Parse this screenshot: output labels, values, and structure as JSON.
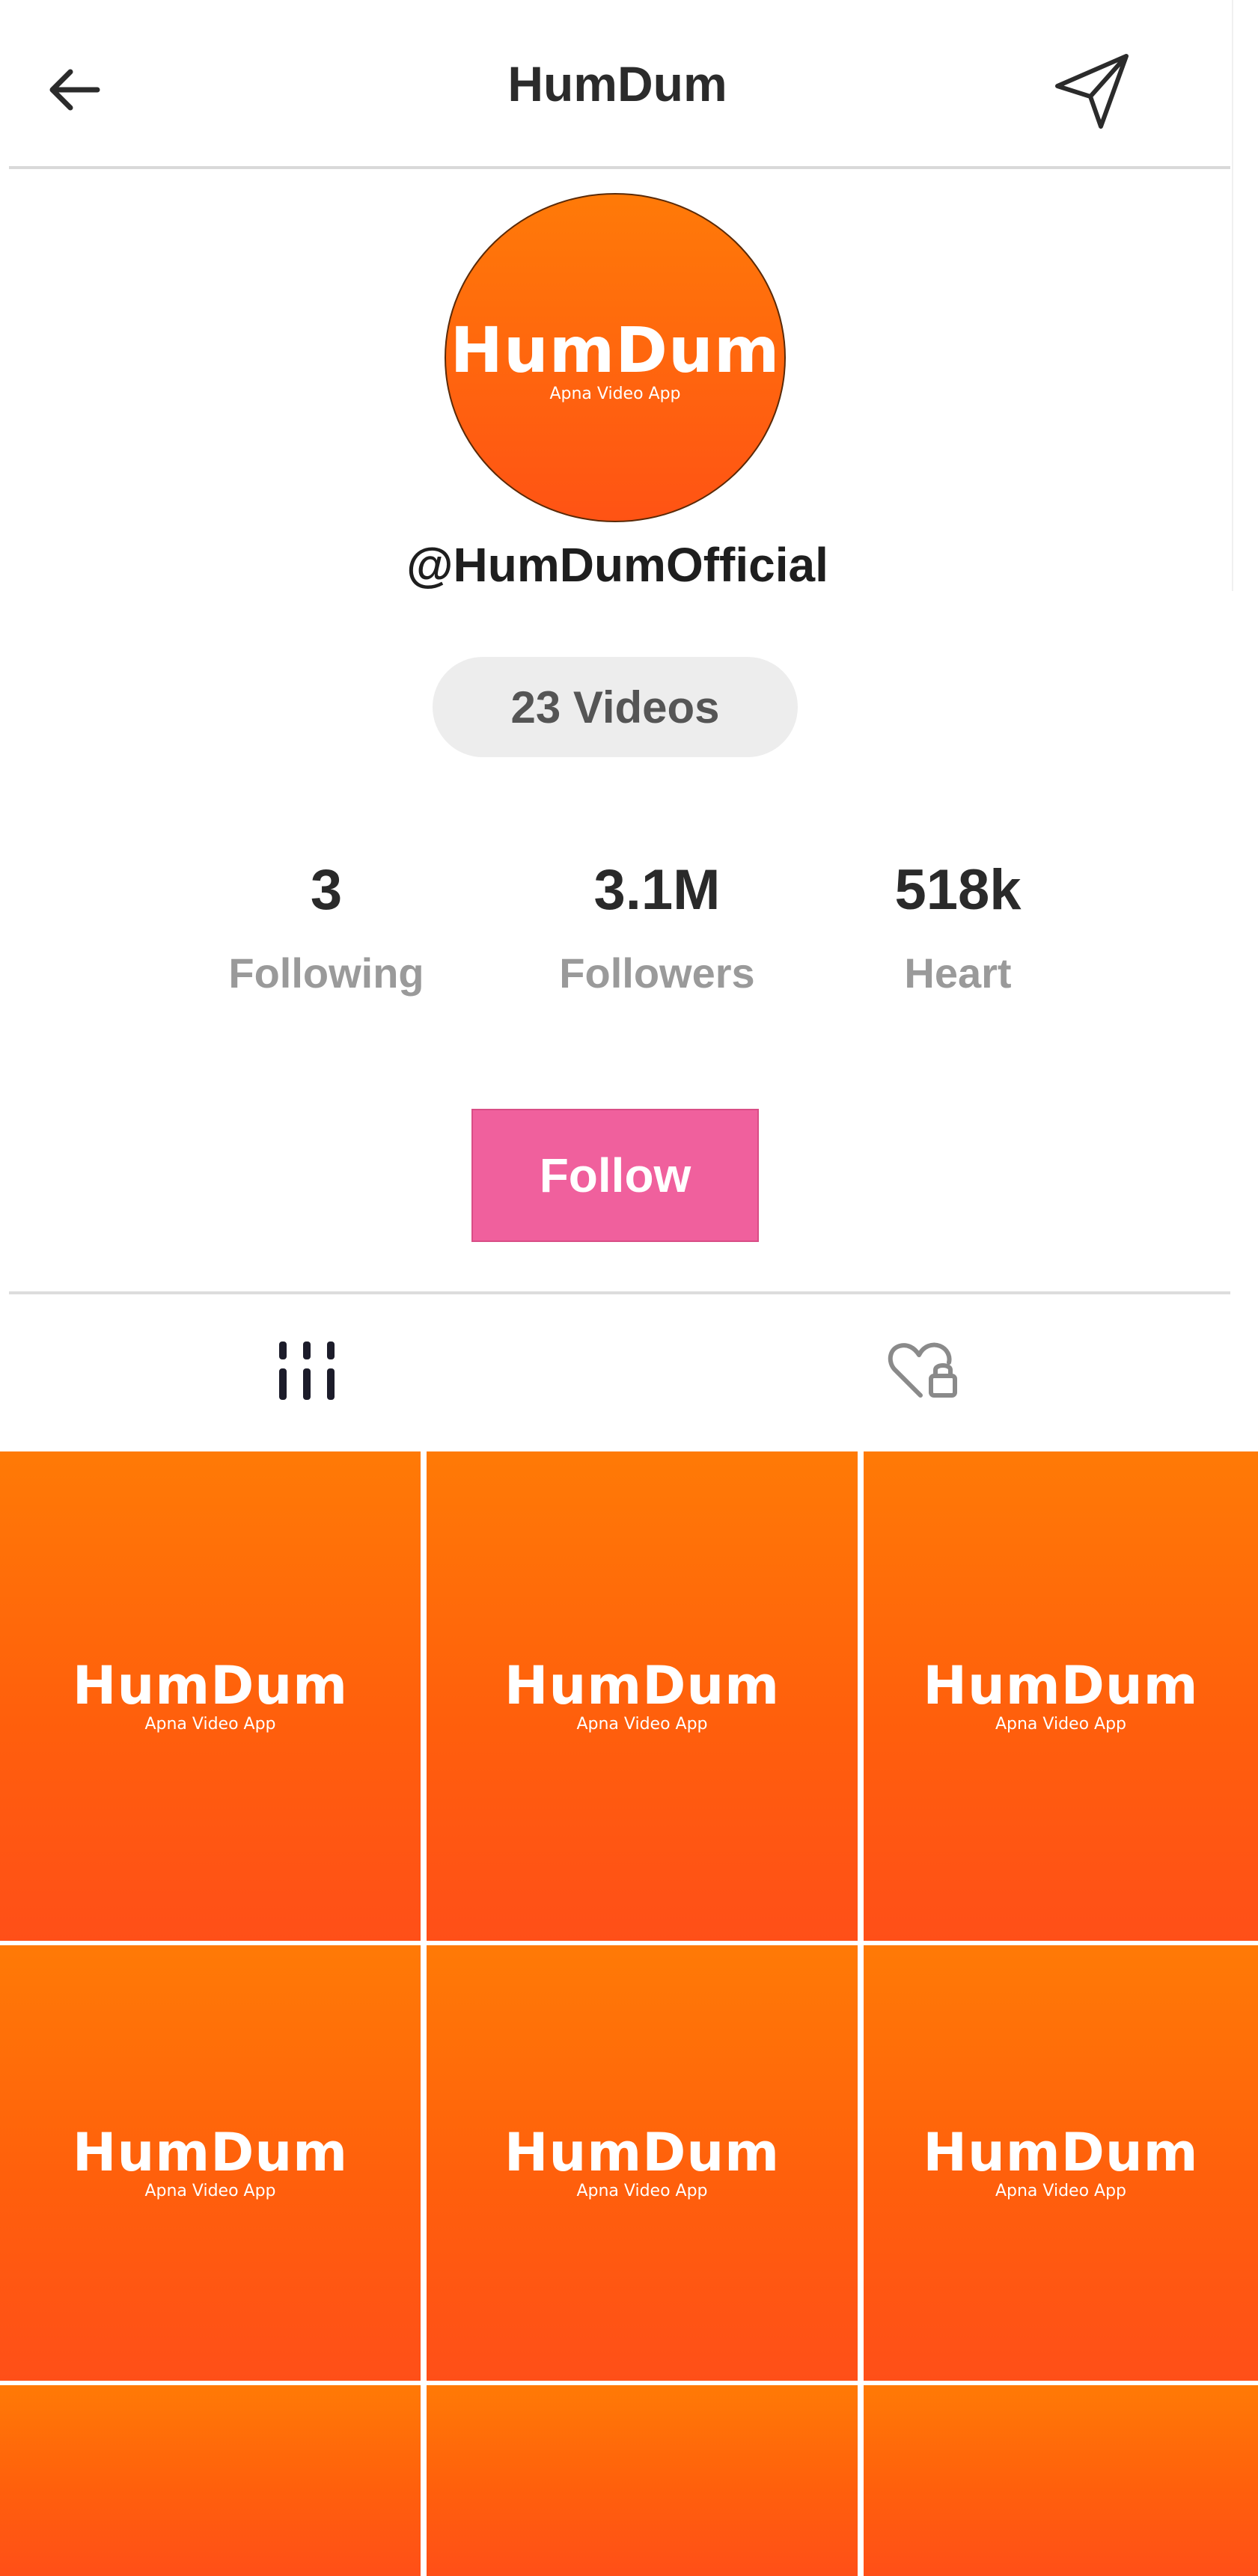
{
  "header": {
    "title": "HumDum",
    "back_icon": "arrow-left-icon",
    "send_icon": "send-icon"
  },
  "profile": {
    "avatar": {
      "logo_text": "HumDum",
      "tagline": "Apna Video App"
    },
    "handle": "@HumDumOfficial",
    "videos_count_label": "23 Videos"
  },
  "stats": [
    {
      "value": "3",
      "label": "Following"
    },
    {
      "value": "3.1M",
      "label": "Followers"
    },
    {
      "value": "518k",
      "label": "Heart"
    }
  ],
  "follow_button": {
    "label": "Follow"
  },
  "tabs": [
    {
      "icon": "grid-bars-icon",
      "active": true
    },
    {
      "icon": "heart-lock-icon",
      "active": false
    }
  ],
  "videos": [
    {
      "logo_text": "HumDum",
      "tagline": "Apna Video App"
    },
    {
      "logo_text": "HumDum",
      "tagline": "Apna Video App"
    },
    {
      "logo_text": "HumDum",
      "tagline": "Apna Video App"
    },
    {
      "logo_text": "HumDum",
      "tagline": "Apna Video App"
    },
    {
      "logo_text": "HumDum",
      "tagline": "Apna Video App"
    },
    {
      "logo_text": "HumDum",
      "tagline": "Apna Video App"
    },
    {},
    {},
    {}
  ],
  "colors": {
    "brand_orange_top": "#ff7a06",
    "brand_orange_bottom": "#ff4f18",
    "follow_pink": "#f0609d",
    "pill_gray": "#ededed"
  }
}
